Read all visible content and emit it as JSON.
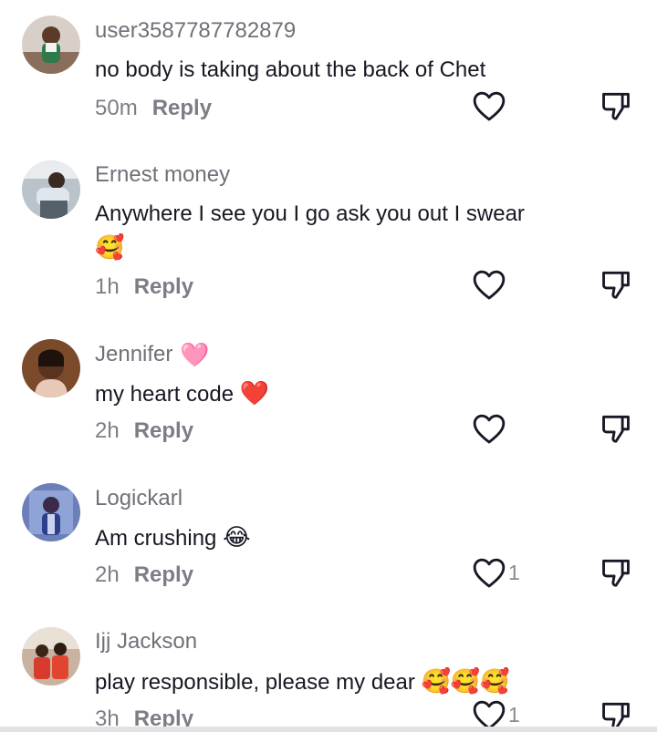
{
  "comments": [
    {
      "username": "user3587787782879",
      "username_emoji": "",
      "text": "no body is taking about the back of Chet",
      "time": "50m",
      "reply": "Reply",
      "likes": ""
    },
    {
      "username": "Ernest money",
      "username_emoji": "",
      "text": "Anywhere I see you I go ask you out I swear",
      "text_emoji": "🥰",
      "time": "1h",
      "reply": "Reply",
      "likes": ""
    },
    {
      "username": "Jennifer",
      "username_emoji": "🩷",
      "text": "my heart code",
      "text_emoji": "❤️",
      "time": "2h",
      "reply": "Reply",
      "likes": ""
    },
    {
      "username": "Logickarl",
      "username_emoji": "",
      "text": "Am crushing",
      "text_emoji": "😂",
      "time": "2h",
      "reply": "Reply",
      "likes": "1"
    },
    {
      "username": "Ijj Jackson",
      "username_emoji": "",
      "text": "play responsible, please my dear",
      "text_emoji": "🥰🥰🥰",
      "time": "3h",
      "reply": "Reply",
      "likes": "1"
    }
  ],
  "icons": {
    "like": "heart-outline-icon",
    "dislike": "thumbs-down-icon"
  },
  "colors": {
    "username": "#6f7178",
    "text": "#161823",
    "meta": "#7c7e85",
    "icon": "#161823"
  }
}
